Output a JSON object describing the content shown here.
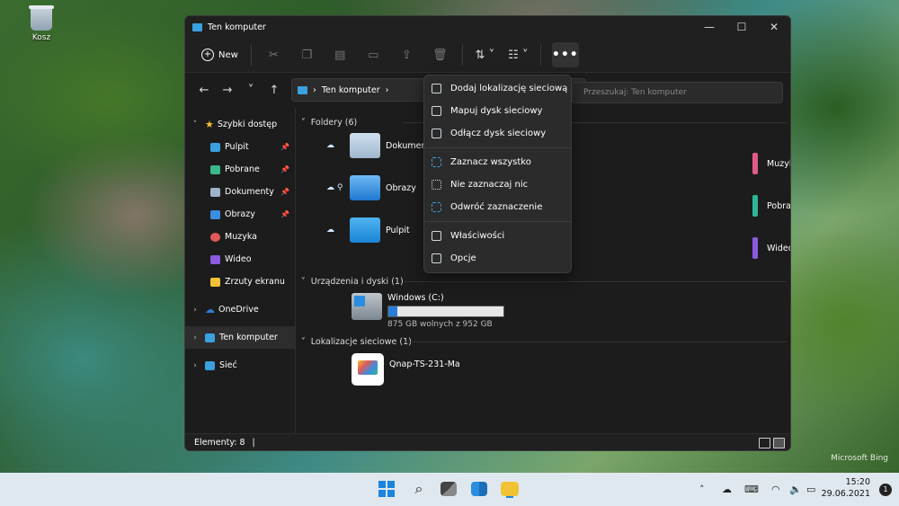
{
  "desktop": {
    "recycle_bin": "Kosz",
    "watermark": "Microsoft Bing"
  },
  "window": {
    "title": "Ten komputer",
    "minimize": "—",
    "maximize": "☐",
    "close": "✕"
  },
  "toolbar": {
    "new_label": "New",
    "more_label": "•••",
    "sort_label": "⇅ ˅",
    "view_label": "☷ ˅"
  },
  "nav": {
    "back": "←",
    "forward": "→",
    "recent": "˅",
    "up": "↑"
  },
  "address": {
    "path": "Ten komputer",
    "sep1": "›",
    "sep2": "›"
  },
  "search": {
    "placeholder": "Przeszukaj: Ten komputer"
  },
  "sidebar": {
    "items": [
      {
        "label": "Szybki dostęp",
        "color": "#f2c236"
      },
      {
        "label": "Pulpit",
        "color": "#3aa0e0"
      },
      {
        "label": "Pobrane",
        "color": "#3ab88a"
      },
      {
        "label": "Dokumenty",
        "color": "#9fb3c8"
      },
      {
        "label": "Obrazy",
        "color": "#3a8ee0"
      },
      {
        "label": "Muzyka",
        "color": "#e05a5a"
      },
      {
        "label": "Wideo",
        "color": "#8a5ae0"
      },
      {
        "label": "Zrzuty ekranu",
        "color": "#f2c236"
      },
      {
        "label": "OneDrive",
        "color": "#2f7fd8"
      },
      {
        "label": "Ten komputer",
        "color": "#3aa0e0"
      },
      {
        "label": "Sieć",
        "color": "#3aa0e0"
      }
    ]
  },
  "content": {
    "group_folders": "Foldery (6)",
    "group_drives": "Urządzenia i dyski (1)",
    "group_network": "Lokalizacje sieciowe (1)",
    "folders": [
      "Dokumenty",
      "Obrazy",
      "Pulpit",
      "Muzyka",
      "Pobrane",
      "Wideo"
    ],
    "drive": {
      "name": "Windows (C:)",
      "free": "875 GB wolnych z 952 GB",
      "used_fraction": 0.08
    },
    "network_item": "Qnap-TS-231-Ma"
  },
  "status": {
    "items": "Elementy: 8"
  },
  "menu": {
    "items": [
      "Dodaj lokalizację sieciową",
      "Mapuj dysk sieciowy",
      "Odłącz dysk sieciowy",
      "Zaznacz wszystko",
      "Nie zaznaczaj nic",
      "Odwróć zaznaczenie",
      "Właściwości",
      "Opcje"
    ]
  },
  "taskbar": {
    "time": "15:20",
    "date": "29.06.2021",
    "notifications": "1"
  }
}
